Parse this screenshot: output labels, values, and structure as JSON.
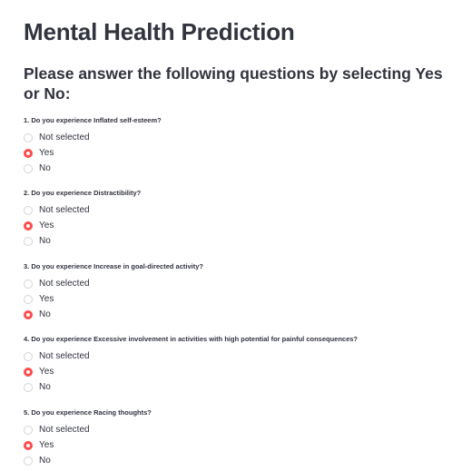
{
  "page": {
    "title": "Mental Health Prediction",
    "subtitle": "Please answer the following questions by selecting Yes or No:"
  },
  "questions": [
    {
      "label": "1. Do you experience Inflated self-esteem?",
      "options": [
        "Not selected",
        "Yes",
        "No"
      ],
      "selected": "Yes"
    },
    {
      "label": "2. Do you experience Distractibility?",
      "options": [
        "Not selected",
        "Yes",
        "No"
      ],
      "selected": "Yes"
    },
    {
      "label": "3. Do you experience Increase in goal-directed activity?",
      "options": [
        "Not selected",
        "Yes",
        "No"
      ],
      "selected": "No"
    },
    {
      "label": "4. Do you experience Excessive involvement in activities with high potential for painful consequences?",
      "options": [
        "Not selected",
        "Yes",
        "No"
      ],
      "selected": "Yes"
    },
    {
      "label": "5. Do you experience Racing thoughts?",
      "options": [
        "Not selected",
        "Yes",
        "No"
      ],
      "selected": "Yes"
    }
  ],
  "colors": {
    "accent": "#ff4b4b",
    "text": "#31333f",
    "radio_border": "#d3d4d9"
  }
}
